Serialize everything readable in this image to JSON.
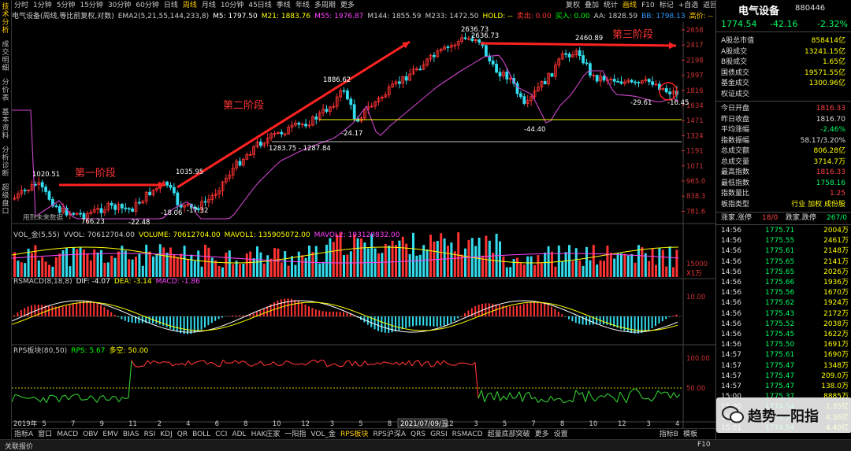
{
  "left_tabs": [
    "技术分析",
    "成交明细",
    "分价表",
    "基本资料",
    "分析诊断",
    "超级盘口"
  ],
  "toolbar": [
    "分时",
    "1分钟",
    "5分钟",
    "15分钟",
    "30分钟",
    "60分钟",
    "日线",
    "周线",
    "月线",
    "10分钟",
    "45日线",
    "季线",
    "年线",
    "多周期",
    "更多"
  ],
  "toolbar_active": "周线",
  "toolbar_right": [
    "复权",
    "叠加",
    "统计",
    "画线",
    "F10",
    "标记",
    "+自选",
    "返回"
  ],
  "toolbar_right_active": "画线",
  "main_legend": [
    {
      "text": "电气设备(周线,等比前复权,对数)",
      "color": "#cccccc"
    },
    {
      "text": "EMA2(5,21,55,144,233,8)",
      "color": "#cccccc"
    },
    {
      "text": "M5: 1797.50",
      "color": "#ffffff"
    },
    {
      "text": "M21: 1883.76",
      "color": "#ffff00"
    },
    {
      "text": "M55: 1976.87",
      "color": "#ff44ff"
    },
    {
      "text": "M144: 1855.59",
      "color": "#cccccc"
    },
    {
      "text": "M233: 1472.50",
      "color": "#cccccc"
    },
    {
      "text": "HOLD: --",
      "color": "#ffff00"
    },
    {
      "text": "卖出: 0.00",
      "color": "#ff3333"
    },
    {
      "text": "买入: 0.00",
      "color": "#00ff00"
    },
    {
      "text": "AA: 1828.59",
      "color": "#cccccc"
    },
    {
      "text": "BB: 1798.13",
      "color": "#3399ff"
    },
    {
      "text": "高价: --",
      "color": "#ffcc00"
    }
  ],
  "annotations": {
    "stage1": "第一阶段",
    "stage2": "第二阶段",
    "stage3": "第三阶段",
    "labels": [
      "2636.73",
      "2636.73",
      "2460.89",
      "1886.62",
      "1035.95",
      "1020.51",
      "-24.17",
      "-44.40",
      "-29.61",
      "-16.45",
      "1283.75 - 1287.84",
      "-18.06",
      "-17.32",
      "766.23",
      "-22.48"
    ],
    "hint": "用到未来数据"
  },
  "price_axis": [
    "2658",
    "2417",
    "2198",
    "1997",
    "1816",
    "1634",
    "1471",
    "1324",
    "1191",
    "1071",
    "965.0",
    "838.3",
    "781.6"
  ],
  "vol_header": [
    {
      "text": "VOL_金(5,55)",
      "color": "#cccccc"
    },
    {
      "text": "VVOL: 70612704.00",
      "color": "#cccccc"
    },
    {
      "text": "VOLUME: 70612704.00",
      "color": "#ffff00"
    },
    {
      "text": "MAVOL1: 135905072.00",
      "color": "#ffff00"
    },
    {
      "text": "MAVOL2: 193120832.00",
      "color": "#ff44ff"
    }
  ],
  "vol_axis": [
    "15000",
    "X1万"
  ],
  "macd_header": [
    {
      "text": "RSMACD(8,18,8)",
      "color": "#cccccc"
    },
    {
      "text": "DIF: -4.07",
      "color": "#ffffff"
    },
    {
      "text": "DEA: -3.14",
      "color": "#ffff00"
    },
    {
      "text": "MACD: -1.86",
      "color": "#ff44ff"
    }
  ],
  "macd_axis": [
    "10.00"
  ],
  "rps_header": [
    {
      "text": "RPS板块(80,50)",
      "color": "#cccccc"
    },
    {
      "text": "RPS: 5.67",
      "color": "#00ff00"
    },
    {
      "text": "多空: 50.00",
      "color": "#ffff00"
    }
  ],
  "rps_axis": [
    "100.00",
    "50.00"
  ],
  "time_axis": [
    "2019年",
    "5",
    "7",
    "9",
    "11",
    "2",
    "4",
    "6",
    "8",
    "10",
    "12",
    "3",
    "5",
    "8",
    "10",
    "12",
    "3",
    "5",
    "7",
    "8",
    "10",
    "12",
    "3",
    "4"
  ],
  "cursor_date": "2021/07/09/五",
  "indicator_tabs": [
    "指标A",
    "窗口",
    "MACD",
    "OBV",
    "EMV",
    "BIAS",
    "RSI",
    "KDJ",
    "QR",
    "BOLL",
    "CCI",
    "ADL",
    "HAK庄家",
    "一阳指",
    "VOL_金",
    "RPS板块",
    "RPS沪深A",
    "QRS",
    "GRSI",
    "RSMACD",
    "超量底部突破",
    "更多",
    "设置"
  ],
  "indicator_active": "RPS板块",
  "indicator_right": [
    "指标B",
    "模板"
  ],
  "status_left": "关联报价",
  "status_right": "F10",
  "rpanel": {
    "title": "电气设备",
    "code": "880446",
    "price": "1774.54",
    "change": "-42.16",
    "pct": "-2.32%",
    "stats1": [
      {
        "k": "A股总市值",
        "v": "858414亿",
        "c": "#ffff00"
      },
      {
        "k": "A股成交",
        "v": "13241.15亿",
        "c": "#ffff00"
      },
      {
        "k": "B股成交",
        "v": "1.65亿",
        "c": "#ffff00"
      },
      {
        "k": "国债成交",
        "v": "19571.55亿",
        "c": "#ffff00"
      },
      {
        "k": "基金成交",
        "v": "1300.96亿",
        "c": "#ffff00"
      },
      {
        "k": "权证成交",
        "v": "",
        "c": "#ffff00"
      }
    ],
    "stats2": [
      {
        "k": "今日开盘",
        "v": "1816.33",
        "c": "#ff4444"
      },
      {
        "k": "昨日收盘",
        "v": "1816.70",
        "c": "#dddddd"
      },
      {
        "k": "平均涨幅",
        "v": "-2.46%",
        "c": "#00ff66"
      },
      {
        "k": "指数振幅",
        "v": "58.17/3.20%",
        "c": "#dddddd"
      },
      {
        "k": "总成交额",
        "v": "806.28亿",
        "c": "#ffff00"
      },
      {
        "k": "总成交量",
        "v": "3714.7万",
        "c": "#ffff00"
      },
      {
        "k": "最高指数",
        "v": "1816.33",
        "c": "#ff4444"
      },
      {
        "k": "最低指数",
        "v": "1758.16",
        "c": "#00ff66"
      },
      {
        "k": "指数量比",
        "v": "1.25",
        "c": "#ff4444"
      },
      {
        "k": "板指类型",
        "v": "行业 加权 成份股",
        "c": "#ffff00"
      }
    ],
    "updown": {
      "k1": "涨家.涨停",
      "v1": "18/0",
      "k2": "跌家.跌停",
      "v2": "267/0"
    },
    "ticks": [
      {
        "t": "14:56",
        "p": "1775.71",
        "v": "2004万"
      },
      {
        "t": "14:56",
        "p": "1775.55",
        "v": "2461万"
      },
      {
        "t": "14:56",
        "p": "1775.61",
        "v": "2148万"
      },
      {
        "t": "14:56",
        "p": "1775.65",
        "v": "2141万"
      },
      {
        "t": "14:56",
        "p": "1775.65",
        "v": "2026万"
      },
      {
        "t": "14:56",
        "p": "1775.66",
        "v": "1936万"
      },
      {
        "t": "14:56",
        "p": "1775.56",
        "v": "1670万"
      },
      {
        "t": "14:56",
        "p": "1775.62",
        "v": "1924万"
      },
      {
        "t": "14:56",
        "p": "1775.43",
        "v": "2172万"
      },
      {
        "t": "14:56",
        "p": "1775.52",
        "v": "2038万"
      },
      {
        "t": "14:56",
        "p": "1775.45",
        "v": "1622万"
      },
      {
        "t": "14:56",
        "p": "1775.50",
        "v": "1691万"
      },
      {
        "t": "14:57",
        "p": "1775.61",
        "v": "1690万"
      },
      {
        "t": "14:57",
        "p": "1775.47",
        "v": "1348万"
      },
      {
        "t": "14:57",
        "p": "1775.47",
        "v": "209.0万"
      },
      {
        "t": "14:57",
        "p": "1775.47",
        "v": "138.0万"
      },
      {
        "t": "15:00",
        "p": "1775.37",
        "v": "8885万"
      },
      {
        "t": "15:00",
        "p": "1774.54",
        "v": "1.35亿"
      },
      {
        "t": "15:01",
        "p": "1774.54",
        "v": "4.36亿"
      },
      {
        "t": "15:01",
        "p": "1774.54",
        "v": "4.40亿"
      }
    ],
    "watermark": "趋势一阳指"
  }
}
